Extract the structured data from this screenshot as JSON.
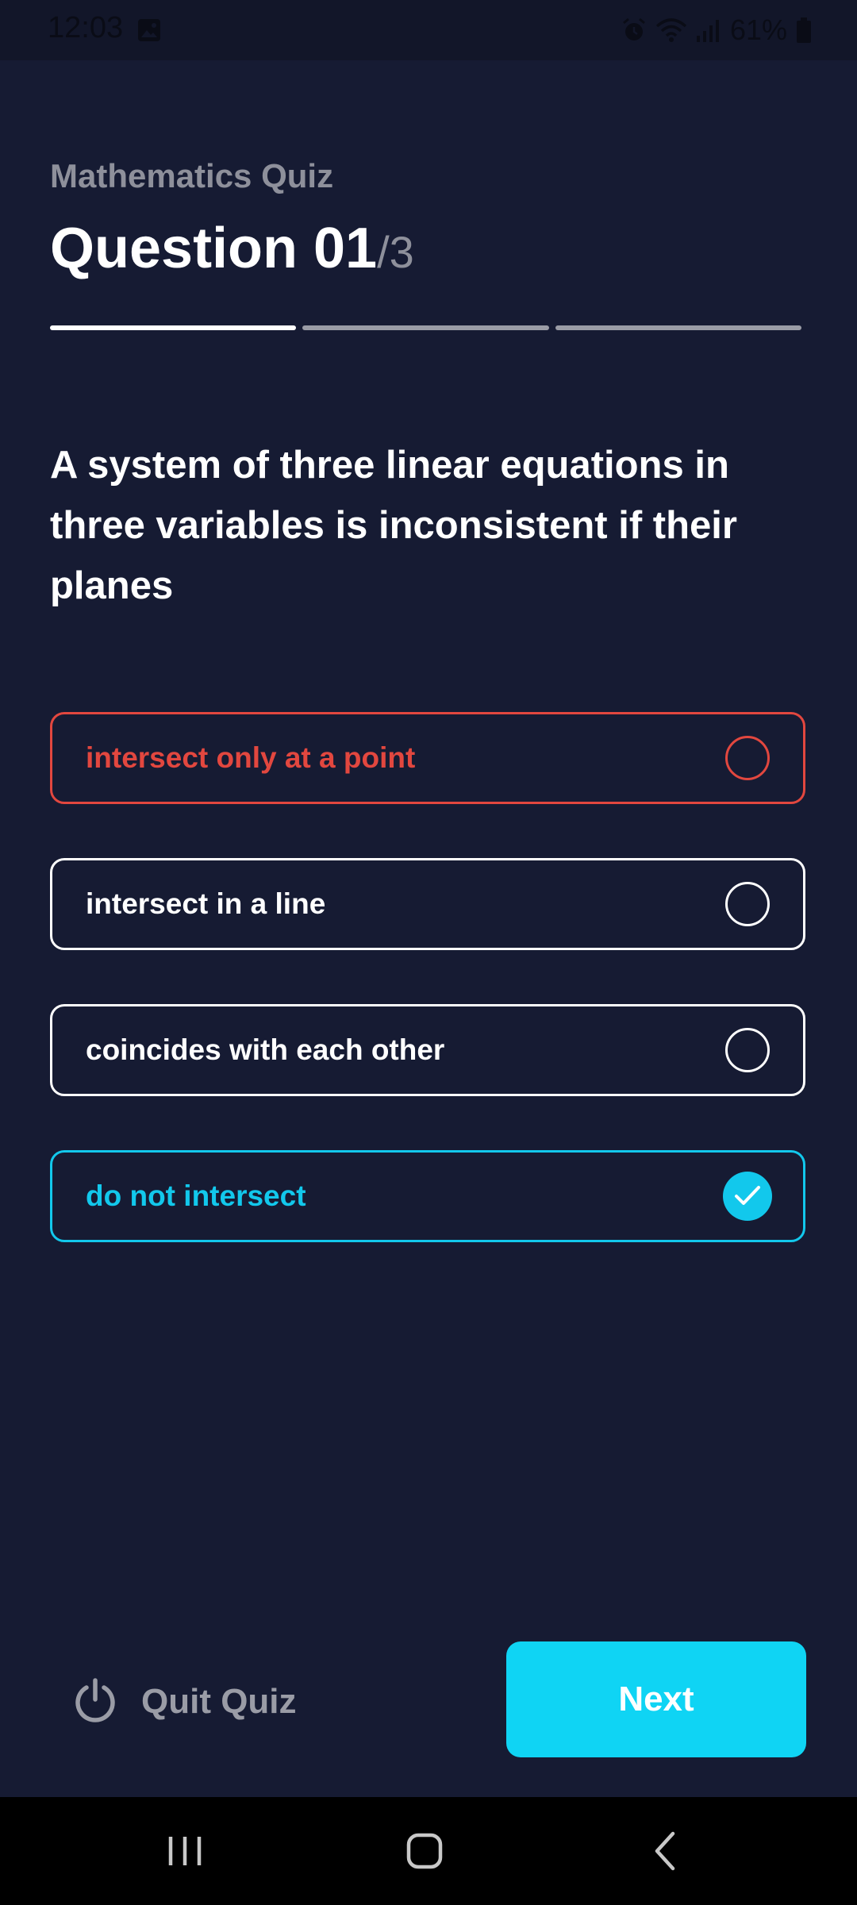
{
  "status_bar": {
    "time": "12:03",
    "battery": "61%",
    "icons": [
      "photo-icon",
      "alarm-icon",
      "wifi-icon",
      "signal-icon",
      "battery-icon"
    ]
  },
  "header": {
    "subtitle": "Mathematics Quiz",
    "question_label": "Question 01",
    "question_total": "/3"
  },
  "progress": {
    "current": 1,
    "total": 3
  },
  "question": {
    "text": "A system of three linear equations in three variables is inconsistent if their planes"
  },
  "options": [
    {
      "label": "intersect only at a point",
      "state": "wrong"
    },
    {
      "label": "intersect in a line",
      "state": "default"
    },
    {
      "label": "coincides with each other",
      "state": "default"
    },
    {
      "label": "do not intersect",
      "state": "correct"
    }
  ],
  "actions": {
    "quit_label": "Quit Quiz",
    "quit_icon": "power-icon",
    "next_label": "Next"
  },
  "colors": {
    "background": "#161b33",
    "accent": "#0fd4f4",
    "wrong": "#e2473f",
    "muted": "#8e909b"
  },
  "nav_bar": {
    "icons": [
      "recent-apps-icon",
      "home-icon",
      "back-icon"
    ]
  }
}
